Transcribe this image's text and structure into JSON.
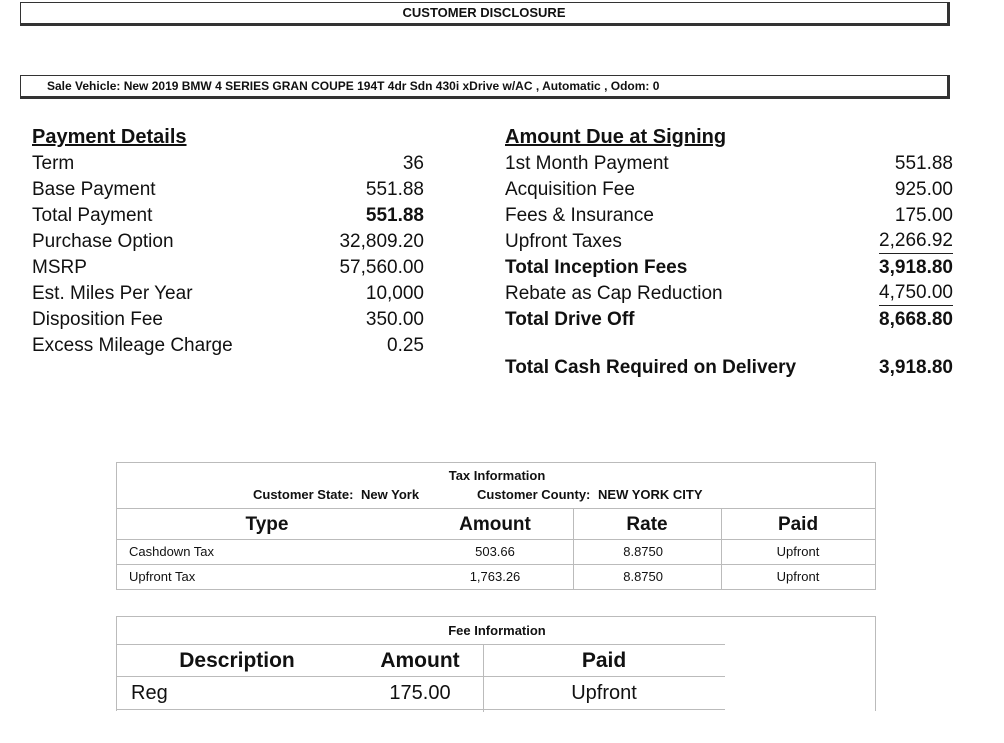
{
  "header": {
    "title": "CUSTOMER DISCLOSURE",
    "vehicle": "Sale Vehicle: New 2019  BMW 4 SERIES GRAN COUPE 194T 4dr Sdn 430i xDrive  w/AC ,  Automatic , Odom: 0"
  },
  "payment_details": {
    "title": "Payment Details",
    "rows": [
      {
        "label": "Term",
        "value": "36"
      },
      {
        "label": "Base Payment",
        "value": "551.88"
      },
      {
        "label": "Total Payment",
        "value": "551.88"
      },
      {
        "label": "Purchase Option",
        "value": "32,809.20"
      },
      {
        "label": "MSRP",
        "value": "57,560.00"
      },
      {
        "label": "Est. Miles Per Year",
        "value": "10,000"
      },
      {
        "label": "Disposition Fee",
        "value": "350.00"
      },
      {
        "label": "Excess Mileage Charge",
        "value": "0.25"
      }
    ]
  },
  "amount_due": {
    "title": "Amount Due at Signing",
    "rows": [
      {
        "label": "1st Month Payment",
        "value": "551.88"
      },
      {
        "label": "Acquisition Fee",
        "value": "925.00"
      },
      {
        "label": "Fees & Insurance",
        "value": "175.00"
      },
      {
        "label": "Upfront Taxes",
        "value": "2,266.92"
      },
      {
        "label": "Total Inception Fees",
        "value": "3,918.80"
      },
      {
        "label": "Rebate as Cap Reduction",
        "value": "4,750.00"
      },
      {
        "label": "Total Drive Off",
        "value": "8,668.80"
      }
    ],
    "total_cash_label": "Total Cash Required on Delivery",
    "total_cash_value": "3,918.80"
  },
  "tax_info": {
    "title": "Tax Information",
    "state_label": "Customer State:",
    "state": "New York",
    "county_label": "Customer County:",
    "county": "NEW YORK CITY",
    "headers": {
      "type": "Type",
      "amount": "Amount",
      "rate": "Rate",
      "paid": "Paid"
    },
    "rows": [
      {
        "type": "Cashdown Tax",
        "amount": "503.66",
        "rate": "8.8750",
        "paid": "Upfront"
      },
      {
        "type": "Upfront Tax",
        "amount": "1,763.26",
        "rate": "8.8750",
        "paid": "Upfront"
      }
    ]
  },
  "fee_info": {
    "title": "Fee Information",
    "headers": {
      "description": "Description",
      "amount": "Amount",
      "paid": "Paid"
    },
    "rows": [
      {
        "description": "Reg",
        "amount": "175.00",
        "paid": "Upfront"
      }
    ]
  }
}
